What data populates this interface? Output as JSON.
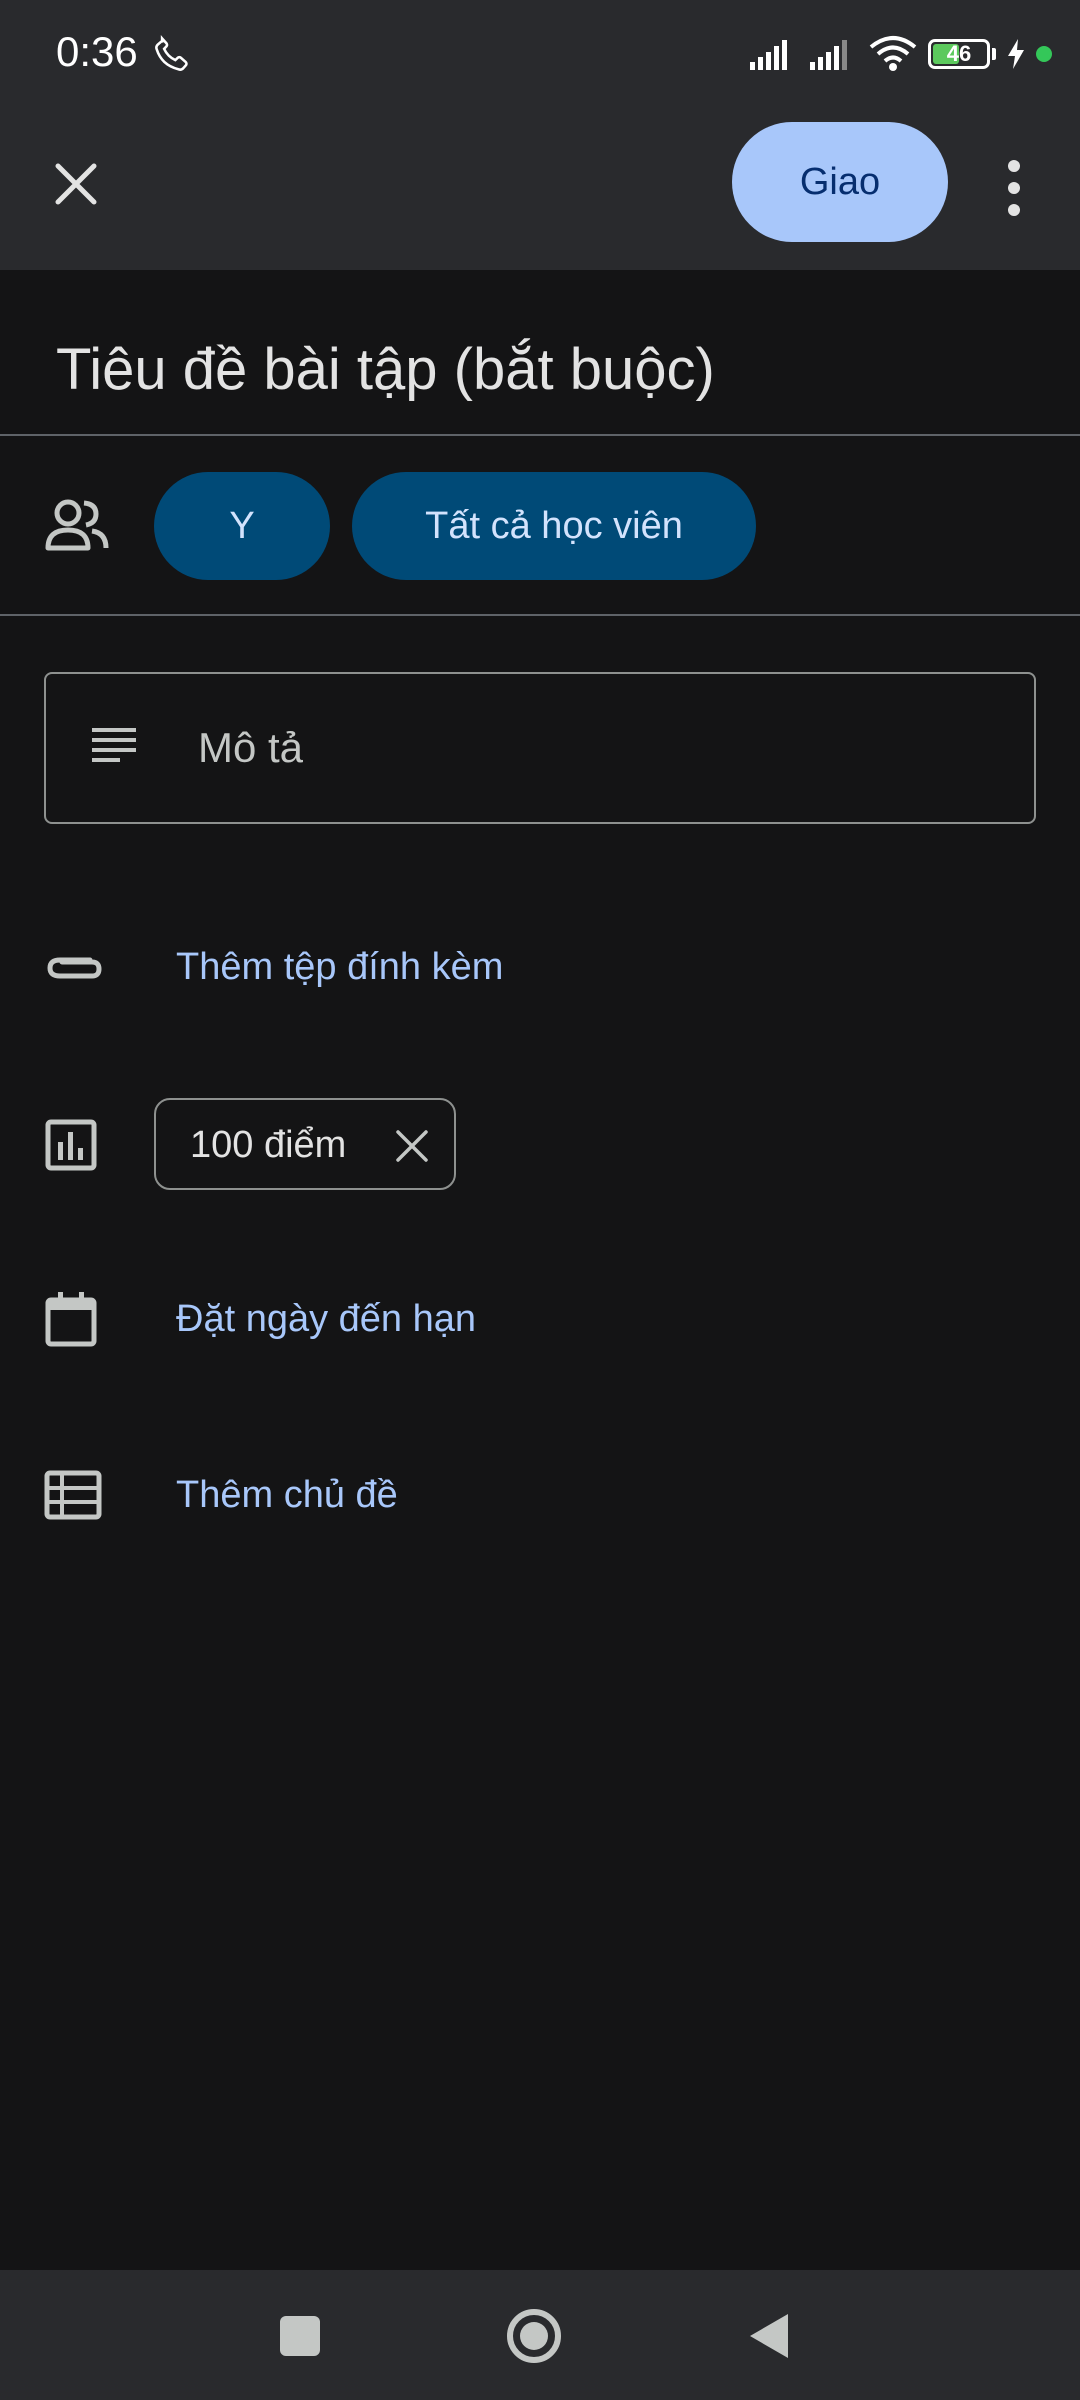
{
  "status_bar": {
    "time": "0:36",
    "battery_level": "46",
    "icons": [
      "phone-icon",
      "signal-icon",
      "signal-icon",
      "wifi-icon",
      "battery-icon",
      "charging-icon",
      "dot-indicator"
    ]
  },
  "toolbar": {
    "close_icon": "close-icon",
    "assign_label": "Giao",
    "more_icon": "more-vert-icon"
  },
  "form": {
    "title_placeholder": "Tiêu đề bài tập (bắt buộc)",
    "recipients": {
      "icon": "people-icon",
      "class_chip": "Y",
      "students_chip": "Tất cả học viên"
    },
    "description_placeholder": "Mô tả",
    "attachment": {
      "icon": "paperclip-icon",
      "label": "Thêm tệp đính kèm"
    },
    "points": {
      "icon": "bar-chart-icon",
      "label": "100 điểm"
    },
    "due_date": {
      "icon": "calendar-icon",
      "label": "Đặt ngày đến hạn"
    },
    "topic": {
      "icon": "topic-icon",
      "label": "Thêm chủ đề"
    }
  },
  "navigation": {
    "buttons": [
      "recents-button",
      "home-button",
      "back-button"
    ]
  },
  "colors": {
    "background": "#141415",
    "app_bar": "#292a2d",
    "primary_button": "#a8c7fa",
    "chip_blue": "#004a77",
    "link_blue": "#a8c7fa",
    "battery_green": "#5cc95d"
  }
}
